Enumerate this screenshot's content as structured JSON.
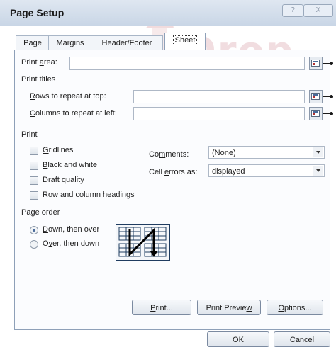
{
  "dialog": {
    "title": "Page Setup",
    "help_glyph": "?",
    "close_glyph": "X"
  },
  "tabs": [
    {
      "label": "Page"
    },
    {
      "label": "Margins"
    },
    {
      "label": "Header/Footer"
    },
    {
      "label": "Sheet",
      "active": true
    }
  ],
  "print_area": {
    "label_pre": "Print ",
    "label_hot": "a",
    "label_post": "rea:",
    "value": ""
  },
  "print_titles": {
    "heading": "Print titles",
    "rows": {
      "label_hot": "R",
      "label_post": "ows to repeat at top:",
      "value": ""
    },
    "columns": {
      "label_hot": "C",
      "label_post": "olumns to repeat at left:",
      "value": ""
    }
  },
  "print": {
    "heading": "Print",
    "gridlines": {
      "hot": "G",
      "post": "ridlines",
      "checked": false
    },
    "black_white": {
      "hot": "B",
      "post": "lack and white",
      "checked": false
    },
    "draft": {
      "pre": "Draft ",
      "hot": "q",
      "post": "uality",
      "checked": false
    },
    "headings": {
      "label": "Row and column headings",
      "checked": false
    },
    "comments": {
      "pre": "Co",
      "hot": "m",
      "post": "ments:",
      "value": "(None)"
    },
    "cell_errors": {
      "pre": "Cell ",
      "hot": "e",
      "post": "rrors as:",
      "value": "displayed"
    }
  },
  "page_order": {
    "heading": "Page order",
    "down_over": {
      "hot": "D",
      "post": "own, then over",
      "selected": true
    },
    "over_down": {
      "pre": "O",
      "hot": "v",
      "post": "er, then down",
      "selected": false
    }
  },
  "buttons": {
    "print": {
      "hot": "P",
      "post": "rint..."
    },
    "preview": {
      "pre": "Print Previe",
      "hot": "w",
      "post": ""
    },
    "options": {
      "hot": "O",
      "post": "ptions..."
    },
    "ok": "OK",
    "cancel": "Cancel"
  },
  "watermark": {
    "text": "Drop Books"
  },
  "colors": {
    "watermark": "#e7c3c7",
    "accent_border": "#8ea0b8"
  }
}
